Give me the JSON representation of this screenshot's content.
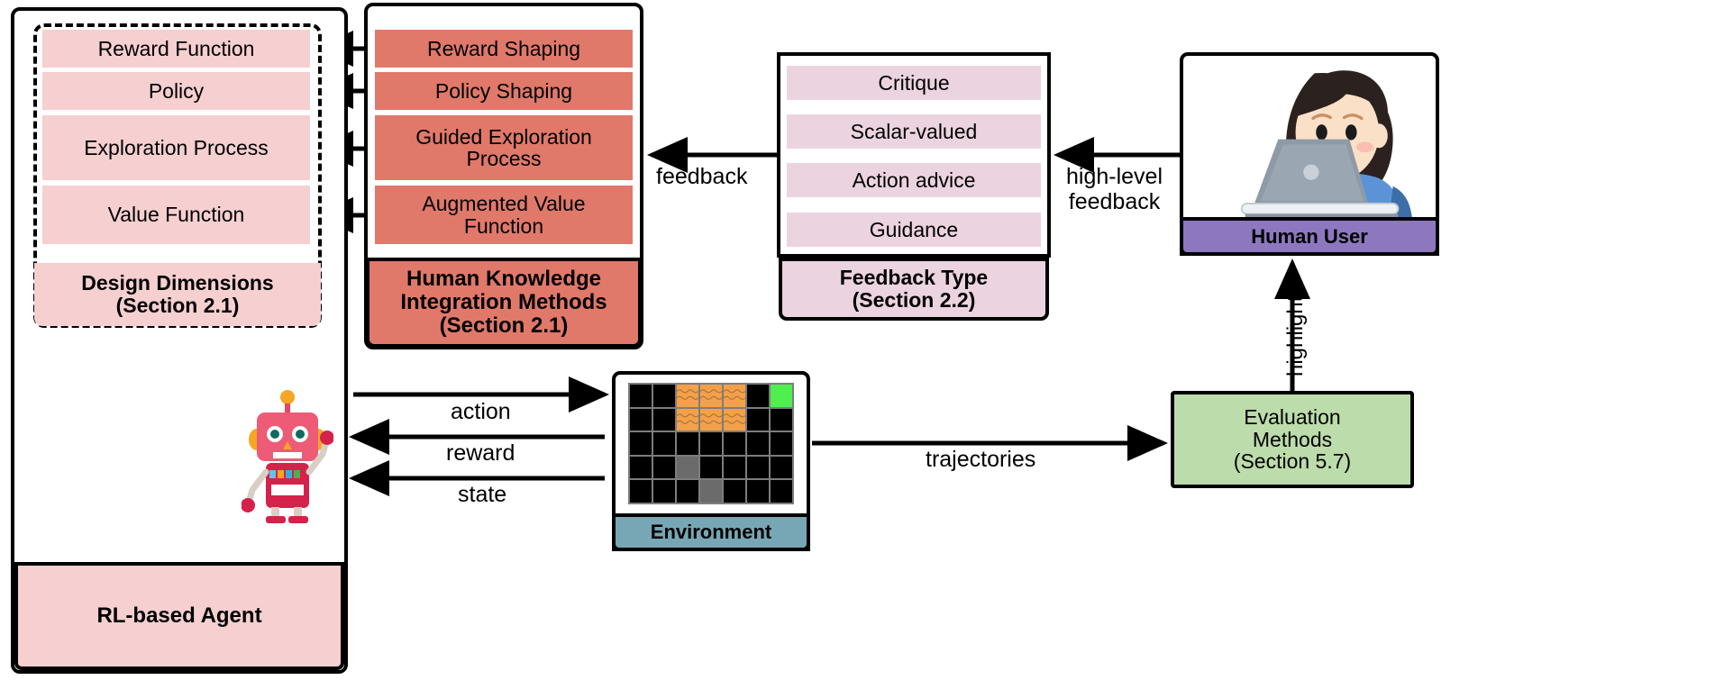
{
  "agent": {
    "caption": "RL-based Agent",
    "design_dimensions": {
      "caption_line1": "Design Dimensions",
      "caption_line2": "(Section 2.1)",
      "items": [
        "Reward Function",
        "Policy",
        "Exploration Process",
        "Value Function"
      ]
    }
  },
  "human_knowledge": {
    "caption_line1": "Human Knowledge",
    "caption_line2": "Integration Methods",
    "caption_line3": "(Section 2.1)",
    "items": [
      "Reward Shaping",
      "Policy Shaping",
      "Guided Exploration Process",
      "Augmented Value Function"
    ]
  },
  "feedback_type": {
    "caption_line1": "Feedback Type",
    "caption_line2": "(Section 2.2)",
    "items": [
      "Critique",
      "Scalar-valued",
      "Action advice",
      "Guidance"
    ]
  },
  "human_user": {
    "caption": "Human User",
    "illustration": "person-at-laptop-illustration"
  },
  "environment": {
    "caption": "Environment",
    "grid": {
      "cols": 7,
      "rows": 5,
      "legend": {
        "empty": "#000000",
        "lava": "#f4a04a",
        "goal": "#4df04d",
        "wall": "#6b6b6b"
      },
      "cells": [
        [
          "empty",
          "empty",
          "lava",
          "lava",
          "lava",
          "empty",
          "goal"
        ],
        [
          "empty",
          "empty",
          "lava",
          "lava",
          "lava",
          "empty",
          "empty"
        ],
        [
          "empty",
          "empty",
          "empty",
          "empty",
          "empty",
          "empty",
          "empty"
        ],
        [
          "empty",
          "empty",
          "gray",
          "empty",
          "empty",
          "empty",
          "empty"
        ],
        [
          "empty",
          "empty",
          "empty",
          "gray",
          "empty",
          "empty",
          "empty"
        ]
      ]
    }
  },
  "evaluation": {
    "line1": "Evaluation",
    "line2": "Methods",
    "line3": "(Section 5.7)"
  },
  "arrows": {
    "feedback": "feedback",
    "high_level_feedback_line1": "high-level",
    "high_level_feedback_line2": "feedback",
    "highlights": "highlights",
    "action": "action",
    "reward": "reward",
    "state": "state",
    "trajectories": "trajectories"
  },
  "colors": {
    "pink": "#f6cfd0",
    "salmon": "#e0796a",
    "mauve": "#ecd3e0",
    "purple": "#8d78c0",
    "green": "#bcdcab",
    "teal": "#77a7b5",
    "stroke": "#000000"
  }
}
